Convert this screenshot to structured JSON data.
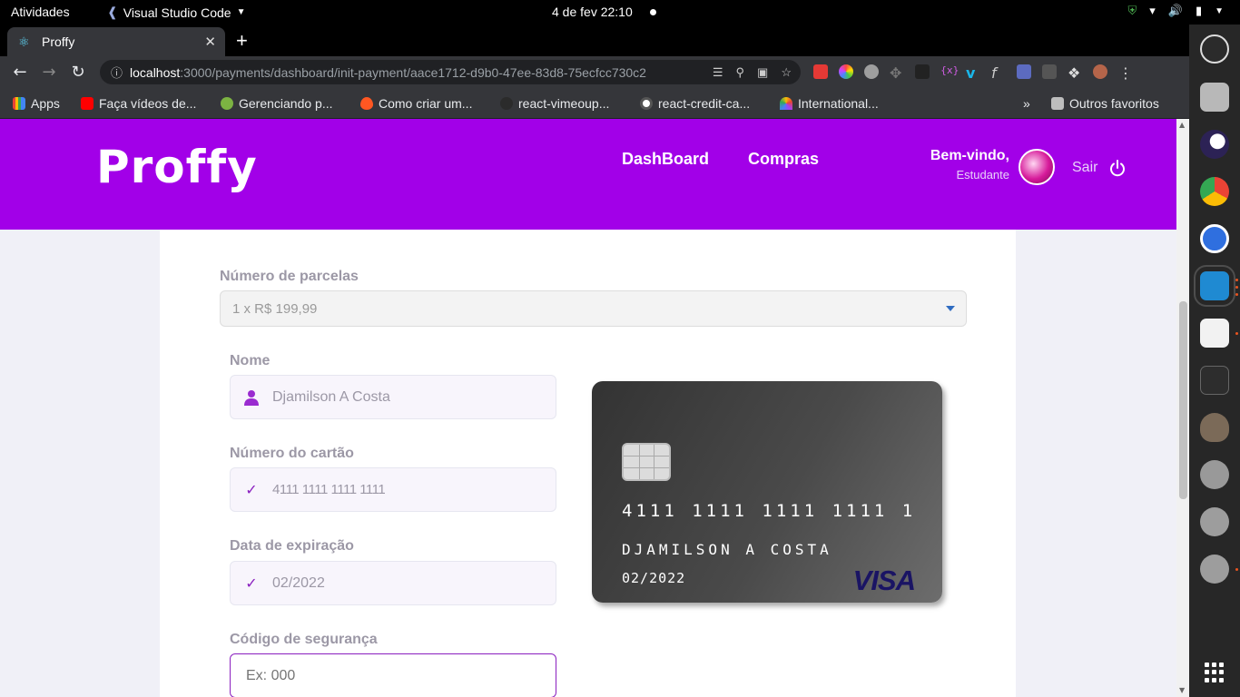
{
  "topbar": {
    "activities": "Atividades",
    "app_name": "Visual Studio Code",
    "datetime": "4 de fev  22:10"
  },
  "browser": {
    "tab_title": "Proffy",
    "url_host": "localhost",
    "url_path": ":3000/payments/dashboard/init-payment/aace1712-d9b0-47ee-83d8-75ecfcc730c2",
    "bookmarks": [
      {
        "label": "Apps",
        "color": "#4285f4"
      },
      {
        "label": "Faça vídeos de...",
        "color": "#ff0000"
      },
      {
        "label": "Gerenciando p...",
        "color": "#7cb342"
      },
      {
        "label": "Como criar um...",
        "color": "#ff5722"
      },
      {
        "label": "react-vimeoup...",
        "color": "#333333"
      },
      {
        "label": "react-credit-ca...",
        "color": "#ffffff"
      },
      {
        "label": "International...",
        "color": "#ff9800"
      }
    ],
    "other_bookmarks": "Outros favoritos"
  },
  "header": {
    "logo": "Proffy",
    "nav": [
      "DashBoard",
      "Compras"
    ],
    "welcome": "Bem-vindo,",
    "role": "Estudante",
    "logout": "Sair"
  },
  "form": {
    "installments_label": "Número de parcelas",
    "installments_value": "1 x R$ 199,99",
    "name_label": "Nome",
    "name_value": "Djamilson A Costa",
    "card_number_label": "Número do cartão",
    "card_number_value": "4111 1111 1111 1111",
    "expiry_label": "Data de expiração",
    "expiry_value": "02/2022",
    "cvv_label": "Código de segurança",
    "cvv_placeholder": "Ex: 000"
  },
  "card_preview": {
    "number": "4111 1111 1111 1111 1",
    "holder": "DJAMILSON A COSTA",
    "expiry": "02/2022",
    "brand": "VISA"
  },
  "colors": {
    "brand_purple": "#a200e8",
    "accent": "#8257e5",
    "dock_accent": "#e95420"
  },
  "dock": [
    {
      "icon": "obs-icon",
      "color": "#2b2b2b"
    },
    {
      "icon": "files-icon",
      "color": "#b8b8b8"
    },
    {
      "icon": "eclipse-icon",
      "color": "#2c2255"
    },
    {
      "icon": "chrome-icon",
      "color": "#4caf50"
    },
    {
      "icon": "web-app-icon",
      "color": "#2f6fdf"
    },
    {
      "icon": "vscode-icon",
      "color": "#1f8ad2"
    },
    {
      "icon": "text-editor-icon",
      "color": "#f2f2f2"
    },
    {
      "icon": "terminal-icon",
      "color": "#2d2d2d"
    },
    {
      "icon": "gimp-icon",
      "color": "#7b6a58"
    },
    {
      "icon": "inkscape-icon",
      "color": "#999999"
    },
    {
      "icon": "disk-icon",
      "color": "#9d9d9d"
    },
    {
      "icon": "disk-icon-2",
      "color": "#9d9d9d"
    }
  ]
}
